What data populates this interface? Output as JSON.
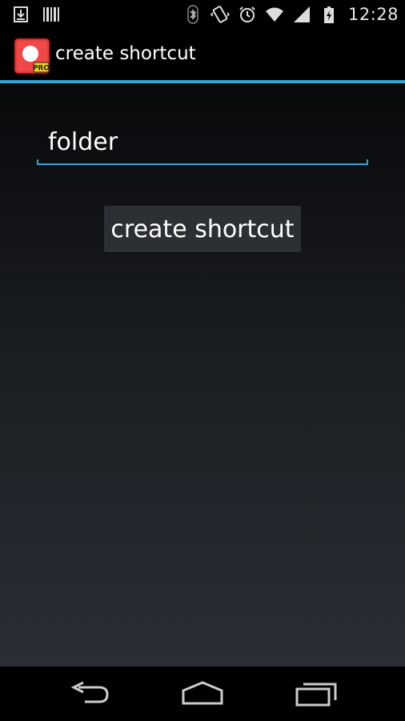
{
  "status_bar": {
    "time": "12:28",
    "left_icons": [
      "download-icon",
      "barcode-icon"
    ],
    "right_icons": [
      "bluetooth-icon",
      "vibrate-icon",
      "alarm-icon",
      "wifi-icon",
      "signal-icon",
      "battery-charging-icon"
    ]
  },
  "action_bar": {
    "title": "create shortcut",
    "app_icon_badge": "PRO",
    "divider_color": "#33a3d4"
  },
  "form": {
    "name_field": {
      "value": "folder"
    },
    "create_button_label": "create shortcut"
  },
  "nav_bar": {
    "icons": [
      "back-icon",
      "home-icon",
      "recents-icon"
    ]
  },
  "colors": {
    "accent": "#33a3d4",
    "background": "#000000",
    "button": "#2c2f33"
  }
}
